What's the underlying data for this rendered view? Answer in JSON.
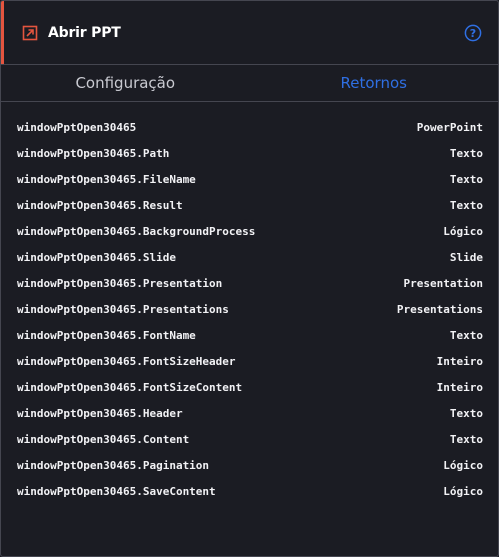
{
  "header": {
    "title": "Abrir PPT",
    "icon": "open-external-icon",
    "help_icon": "help-circle-icon",
    "accent_color": "#e4553f",
    "help_color": "#2f6fe3"
  },
  "tabs": [
    {
      "label": "Configuração",
      "active": false
    },
    {
      "label": "Retornos",
      "active": true
    }
  ],
  "returns": [
    {
      "name": "windowPptOpen30465",
      "type": "PowerPoint"
    },
    {
      "name": "windowPptOpen30465.Path",
      "type": "Texto"
    },
    {
      "name": "windowPptOpen30465.FileName",
      "type": "Texto"
    },
    {
      "name": "windowPptOpen30465.Result",
      "type": "Texto"
    },
    {
      "name": "windowPptOpen30465.BackgroundProcess",
      "type": "Lógico"
    },
    {
      "name": "windowPptOpen30465.Slide",
      "type": "Slide"
    },
    {
      "name": "windowPptOpen30465.Presentation",
      "type": "Presentation"
    },
    {
      "name": "windowPptOpen30465.Presentations",
      "type": "Presentations"
    },
    {
      "name": "windowPptOpen30465.FontName",
      "type": "Texto"
    },
    {
      "name": "windowPptOpen30465.FontSizeHeader",
      "type": "Inteiro"
    },
    {
      "name": "windowPptOpen30465.FontSizeContent",
      "type": "Inteiro"
    },
    {
      "name": "windowPptOpen30465.Header",
      "type": "Texto"
    },
    {
      "name": "windowPptOpen30465.Content",
      "type": "Texto"
    },
    {
      "name": "windowPptOpen30465.Pagination",
      "type": "Lógico"
    },
    {
      "name": "windowPptOpen30465.SaveContent",
      "type": "Lógico"
    }
  ]
}
